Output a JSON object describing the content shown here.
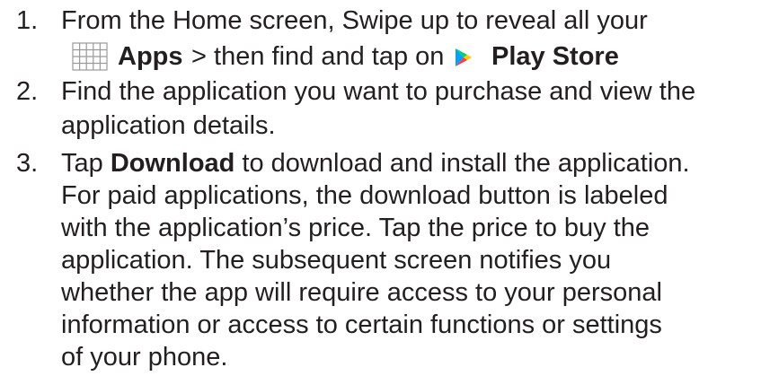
{
  "steps": [
    {
      "number": "1.",
      "line1": "From the Home screen, Swipe up to reveal all your",
      "apps_label": "Apps",
      "mid_text": " > then find and tap on ",
      "store_label": "Play Store",
      "icons": [
        "apps-grid-icon",
        "play-store-icon"
      ]
    },
    {
      "number": "2.",
      "lines": [
        "Find the application you want to purchase and view the",
        "application details."
      ]
    },
    {
      "number": "3.",
      "line1_prefix": "Tap ",
      "line1_bold": "Download",
      "line1_suffix": " to download and install the application.",
      "lines": [
        "For paid applications, the download button is labeled",
        "with the application’s price. Tap the price to buy the",
        "application. The subsequent screen notifies you",
        "whether the app will require access to your personal",
        "information or access to certain functions or settings",
        "of your phone."
      ]
    }
  ],
  "colors": {
    "text": "#231f20",
    "apps_icon_stroke": "#9a9a9a",
    "play_green": "#00d26a",
    "play_blue": "#00a0ff",
    "play_yellow": "#ffc800",
    "play_red": "#ff3a44"
  }
}
